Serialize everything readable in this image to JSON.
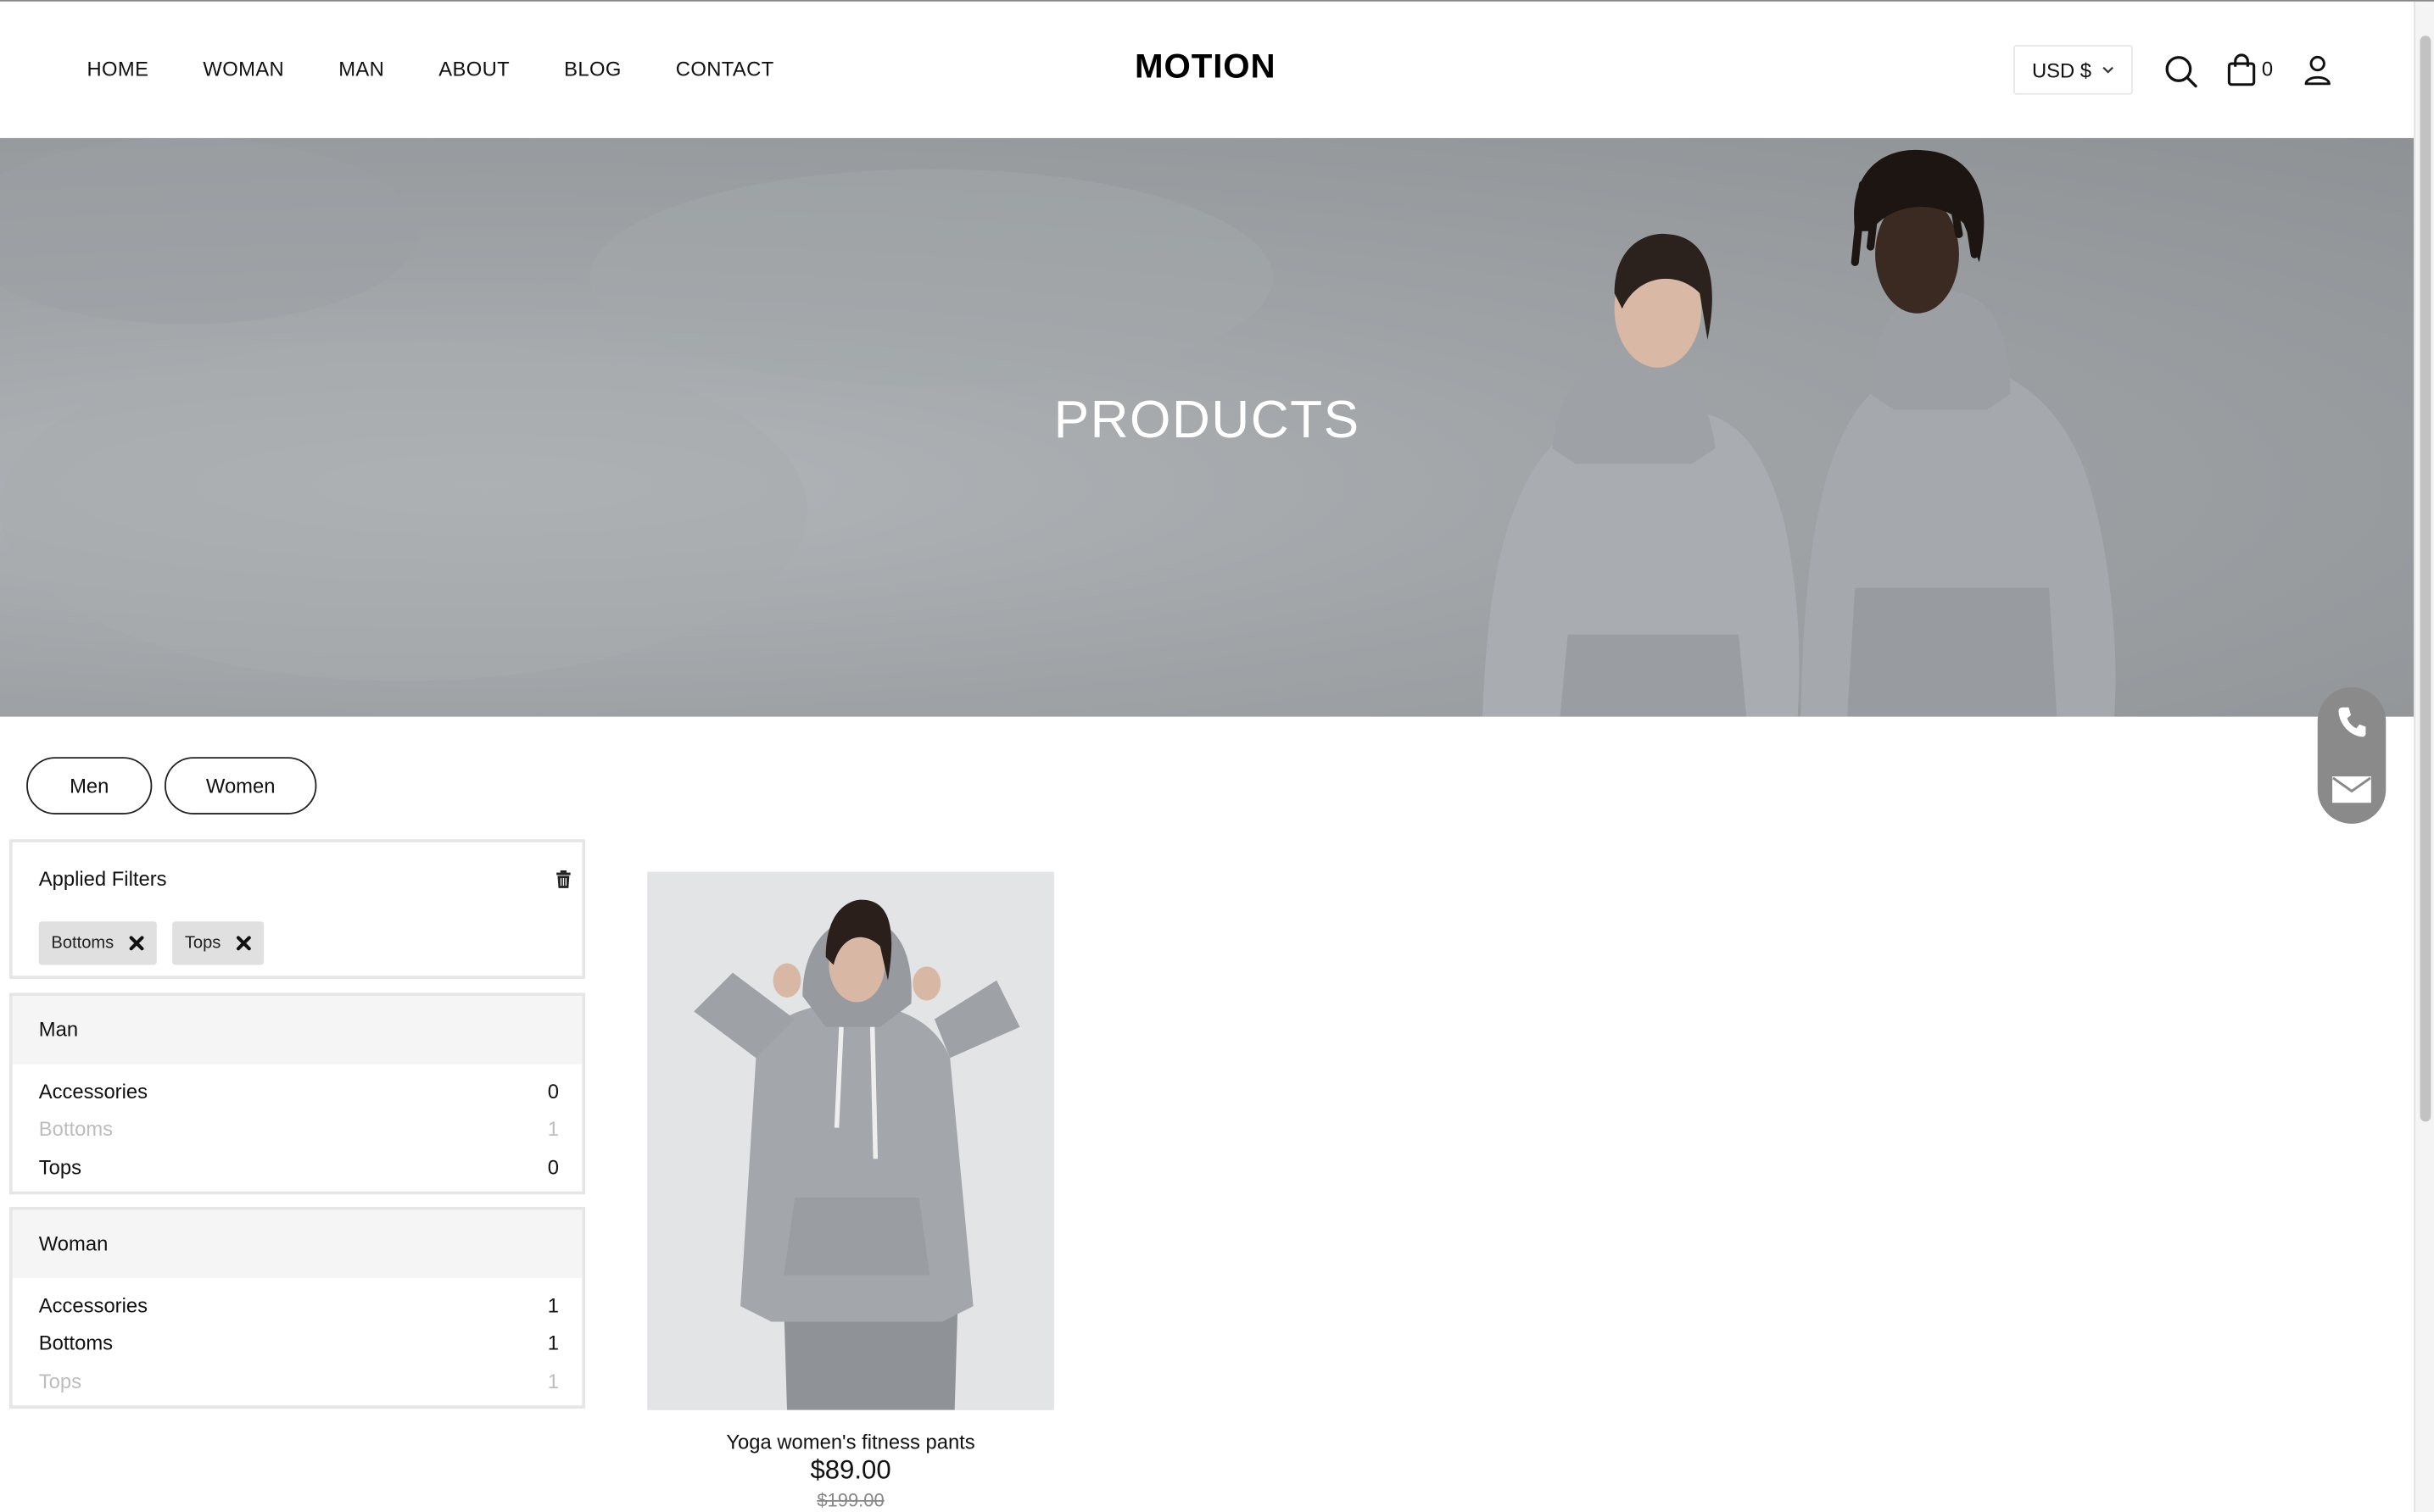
{
  "header": {
    "nav": [
      "HOME",
      "WOMAN",
      "MAN",
      "ABOUT",
      "BLOG",
      "CONTACT"
    ],
    "logo": "MOTION",
    "currency": "USD $",
    "cart_count": "0",
    "icons": [
      "search-icon",
      "shopping-bag-icon",
      "user-icon"
    ]
  },
  "hero": {
    "title": "PRODUCTS"
  },
  "filters": {
    "gender_buttons": [
      "Men",
      "Women"
    ],
    "applied": {
      "title": "Applied Filters",
      "chips": [
        "Bottoms",
        "Tops"
      ]
    },
    "groups": [
      {
        "title": "Man",
        "items": [
          {
            "label": "Accessories",
            "count": "0",
            "selected": false
          },
          {
            "label": "Bottoms",
            "count": "1",
            "selected": true
          },
          {
            "label": "Tops",
            "count": "0",
            "selected": false
          }
        ]
      },
      {
        "title": "Woman",
        "items": [
          {
            "label": "Accessories",
            "count": "1",
            "selected": false
          },
          {
            "label": "Bottoms",
            "count": "1",
            "selected": false
          },
          {
            "label": "Tops",
            "count": "1",
            "selected": true
          }
        ]
      }
    ]
  },
  "products": [
    {
      "name": "Yoga women's fitness pants",
      "price": "$89.00",
      "old_price": "$199.00"
    }
  ],
  "floating_contact": {
    "icons": [
      "phone-icon",
      "mail-icon"
    ]
  },
  "colors": {
    "text": "#111111",
    "panel_border": "#e6e6e6",
    "chip_bg": "#e0e0e0",
    "dim_text": "#bdbdbd",
    "float_bg": "#8a8a8a"
  }
}
